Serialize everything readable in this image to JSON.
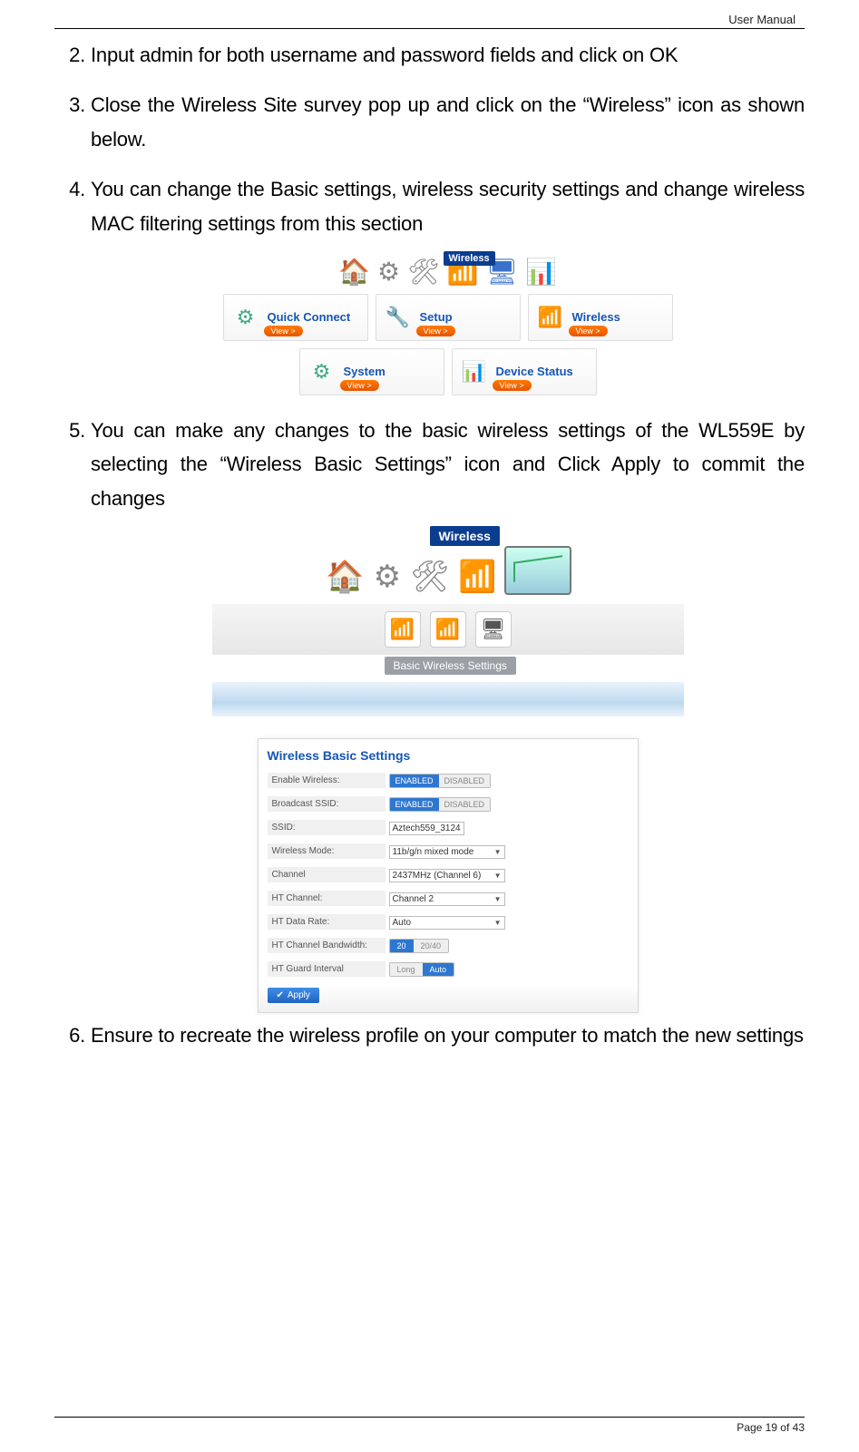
{
  "header": {
    "right": "User Manual"
  },
  "steps": {
    "start": 2,
    "items": [
      "Input admin for both username and password fields and click on OK",
      "Close the Wireless Site survey pop up and click on the “Wireless” icon as shown below.",
      "You can change the Basic settings, wireless security settings and change wireless MAC filtering settings from this section",
      "You can make any changes to the basic wireless settings of the WL559E by selecting the “Wireless Basic Settings” icon and Click Apply to commit the changes",
      "Ensure to recreate the wireless profile on your computer to match the new settings"
    ]
  },
  "fig1": {
    "tooltip": "Wireless",
    "cards": [
      {
        "label": "Quick Connect",
        "btn": "View >"
      },
      {
        "label": "Setup",
        "btn": "View >"
      },
      {
        "label": "Wireless",
        "btn": "View >"
      },
      {
        "label": "System",
        "btn": "View >"
      },
      {
        "label": "Device Status",
        "btn": "View >"
      }
    ]
  },
  "fig2": {
    "tooltip": "Wireless",
    "subnav_tooltip": "Basic Wireless Settings"
  },
  "fig3": {
    "title": "Wireless Basic Settings",
    "rows": {
      "enable_wireless": {
        "label": "Enable Wireless:",
        "on": "ENABLED",
        "off": "DISABLED"
      },
      "broadcast_ssid": {
        "label": "Broadcast SSID:",
        "on": "ENABLED",
        "off": "DISABLED"
      },
      "ssid": {
        "label": "SSID:",
        "value": "Aztech559_3124"
      },
      "wireless_mode": {
        "label": "Wireless Mode:",
        "value": "11b/g/n mixed mode"
      },
      "channel": {
        "label": "Channel",
        "value": "2437MHz (Channel 6)"
      },
      "ht_channel": {
        "label": "HT Channel:",
        "value": "Channel 2"
      },
      "ht_data_rate": {
        "label": "HT Data Rate:",
        "value": "Auto"
      },
      "ht_bw": {
        "label": "HT Channel Bandwidth:",
        "a": "20",
        "b": "20/40"
      },
      "ht_gi": {
        "label": "HT Guard Interval",
        "a": "Long",
        "b": "Auto"
      }
    },
    "apply": "Apply"
  },
  "footer": {
    "text": "Page 19 of 43"
  }
}
